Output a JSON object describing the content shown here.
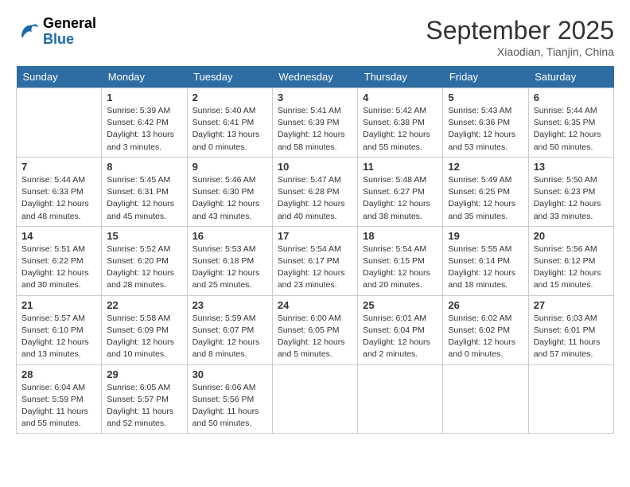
{
  "header": {
    "logo": {
      "line1": "General",
      "line2": "Blue"
    },
    "title": "September 2025",
    "subtitle": "Xiaodian, Tianjin, China"
  },
  "weekdays": [
    "Sunday",
    "Monday",
    "Tuesday",
    "Wednesday",
    "Thursday",
    "Friday",
    "Saturday"
  ],
  "weeks": [
    [
      {
        "day": null
      },
      {
        "day": "1",
        "sunrise": "5:39 AM",
        "sunset": "6:42 PM",
        "daylight": "13 hours and 3 minutes."
      },
      {
        "day": "2",
        "sunrise": "5:40 AM",
        "sunset": "6:41 PM",
        "daylight": "13 hours and 0 minutes."
      },
      {
        "day": "3",
        "sunrise": "5:41 AM",
        "sunset": "6:39 PM",
        "daylight": "12 hours and 58 minutes."
      },
      {
        "day": "4",
        "sunrise": "5:42 AM",
        "sunset": "6:38 PM",
        "daylight": "12 hours and 55 minutes."
      },
      {
        "day": "5",
        "sunrise": "5:43 AM",
        "sunset": "6:36 PM",
        "daylight": "12 hours and 53 minutes."
      },
      {
        "day": "6",
        "sunrise": "5:44 AM",
        "sunset": "6:35 PM",
        "daylight": "12 hours and 50 minutes."
      }
    ],
    [
      {
        "day": "7",
        "sunrise": "5:44 AM",
        "sunset": "6:33 PM",
        "daylight": "12 hours and 48 minutes."
      },
      {
        "day": "8",
        "sunrise": "5:45 AM",
        "sunset": "6:31 PM",
        "daylight": "12 hours and 45 minutes."
      },
      {
        "day": "9",
        "sunrise": "5:46 AM",
        "sunset": "6:30 PM",
        "daylight": "12 hours and 43 minutes."
      },
      {
        "day": "10",
        "sunrise": "5:47 AM",
        "sunset": "6:28 PM",
        "daylight": "12 hours and 40 minutes."
      },
      {
        "day": "11",
        "sunrise": "5:48 AM",
        "sunset": "6:27 PM",
        "daylight": "12 hours and 38 minutes."
      },
      {
        "day": "12",
        "sunrise": "5:49 AM",
        "sunset": "6:25 PM",
        "daylight": "12 hours and 35 minutes."
      },
      {
        "day": "13",
        "sunrise": "5:50 AM",
        "sunset": "6:23 PM",
        "daylight": "12 hours and 33 minutes."
      }
    ],
    [
      {
        "day": "14",
        "sunrise": "5:51 AM",
        "sunset": "6:22 PM",
        "daylight": "12 hours and 30 minutes."
      },
      {
        "day": "15",
        "sunrise": "5:52 AM",
        "sunset": "6:20 PM",
        "daylight": "12 hours and 28 minutes."
      },
      {
        "day": "16",
        "sunrise": "5:53 AM",
        "sunset": "6:18 PM",
        "daylight": "12 hours and 25 minutes."
      },
      {
        "day": "17",
        "sunrise": "5:54 AM",
        "sunset": "6:17 PM",
        "daylight": "12 hours and 23 minutes."
      },
      {
        "day": "18",
        "sunrise": "5:54 AM",
        "sunset": "6:15 PM",
        "daylight": "12 hours and 20 minutes."
      },
      {
        "day": "19",
        "sunrise": "5:55 AM",
        "sunset": "6:14 PM",
        "daylight": "12 hours and 18 minutes."
      },
      {
        "day": "20",
        "sunrise": "5:56 AM",
        "sunset": "6:12 PM",
        "daylight": "12 hours and 15 minutes."
      }
    ],
    [
      {
        "day": "21",
        "sunrise": "5:57 AM",
        "sunset": "6:10 PM",
        "daylight": "12 hours and 13 minutes."
      },
      {
        "day": "22",
        "sunrise": "5:58 AM",
        "sunset": "6:09 PM",
        "daylight": "12 hours and 10 minutes."
      },
      {
        "day": "23",
        "sunrise": "5:59 AM",
        "sunset": "6:07 PM",
        "daylight": "12 hours and 8 minutes."
      },
      {
        "day": "24",
        "sunrise": "6:00 AM",
        "sunset": "6:05 PM",
        "daylight": "12 hours and 5 minutes."
      },
      {
        "day": "25",
        "sunrise": "6:01 AM",
        "sunset": "6:04 PM",
        "daylight": "12 hours and 2 minutes."
      },
      {
        "day": "26",
        "sunrise": "6:02 AM",
        "sunset": "6:02 PM",
        "daylight": "12 hours and 0 minutes."
      },
      {
        "day": "27",
        "sunrise": "6:03 AM",
        "sunset": "6:01 PM",
        "daylight": "11 hours and 57 minutes."
      }
    ],
    [
      {
        "day": "28",
        "sunrise": "6:04 AM",
        "sunset": "5:59 PM",
        "daylight": "11 hours and 55 minutes."
      },
      {
        "day": "29",
        "sunrise": "6:05 AM",
        "sunset": "5:57 PM",
        "daylight": "11 hours and 52 minutes."
      },
      {
        "day": "30",
        "sunrise": "6:06 AM",
        "sunset": "5:56 PM",
        "daylight": "11 hours and 50 minutes."
      },
      {
        "day": null
      },
      {
        "day": null
      },
      {
        "day": null
      },
      {
        "day": null
      }
    ]
  ],
  "labels": {
    "sunrise_prefix": "Sunrise: ",
    "sunset_prefix": "Sunset: ",
    "daylight_prefix": "Daylight: "
  }
}
